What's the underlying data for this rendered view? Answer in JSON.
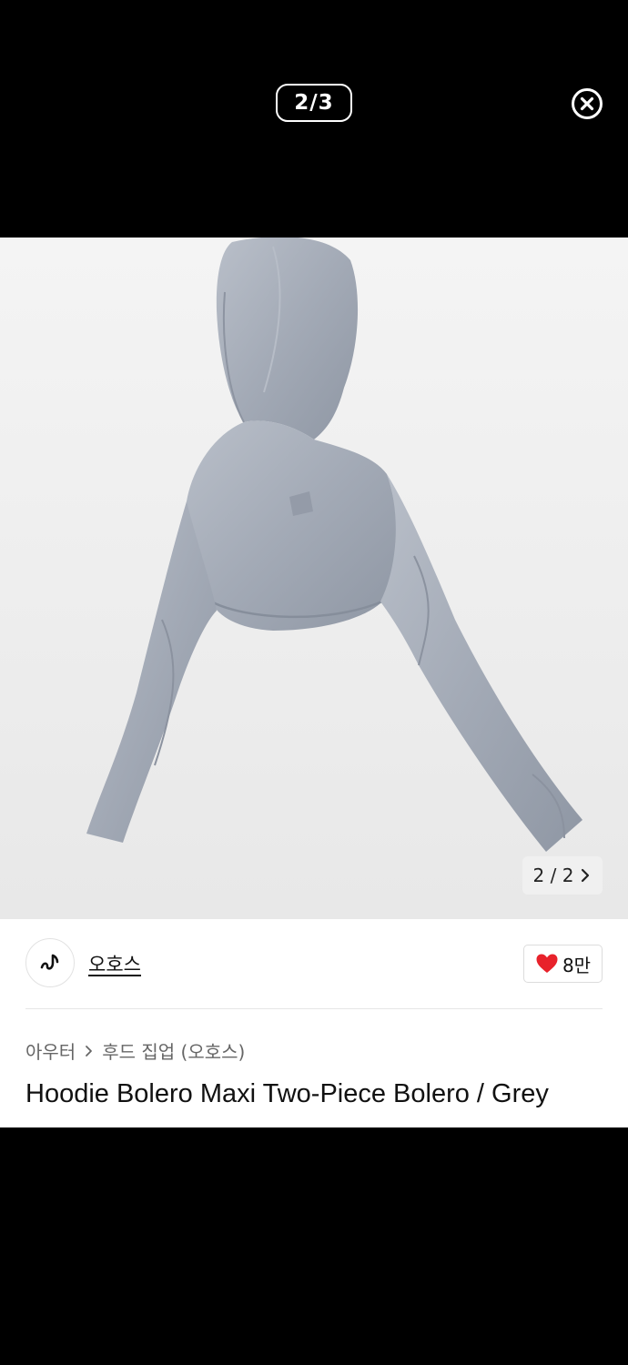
{
  "viewer": {
    "counter": "2/3",
    "close_icon": "close-circle-icon"
  },
  "gallery": {
    "counter": "2 / 2",
    "next_icon": "chevron-right-icon"
  },
  "brand": {
    "name": "오호스",
    "logo_icon": "brand-logo-icon"
  },
  "like": {
    "count": "8만",
    "icon": "heart-icon",
    "color": "#e8222b"
  },
  "breadcrumb": {
    "category": "아우터",
    "separator_icon": "chevron-right-icon",
    "subcategory": "후드 집업 (오호스)"
  },
  "product": {
    "title": "Hoodie Bolero Maxi Two-Piece Bolero / Grey"
  }
}
